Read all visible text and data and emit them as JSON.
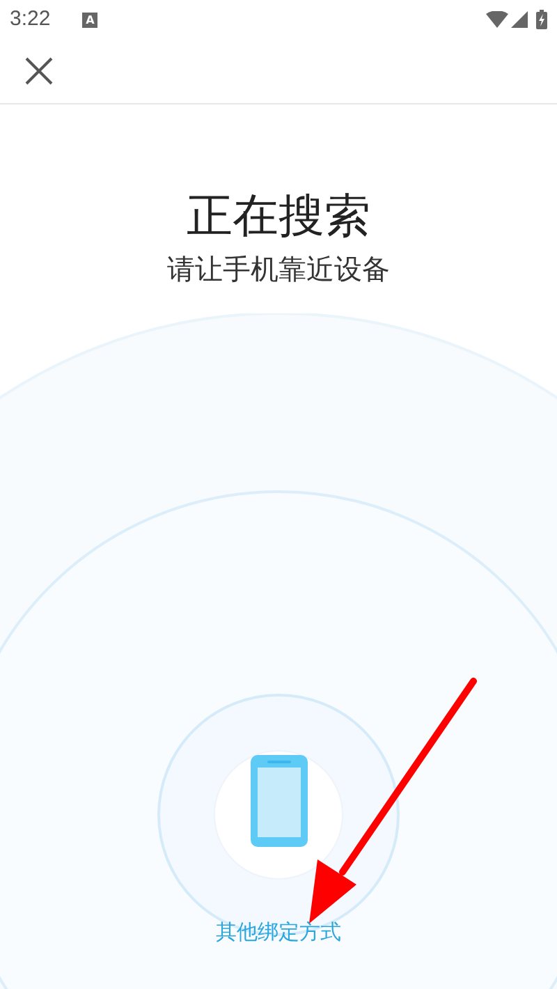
{
  "status_bar": {
    "time": "3:22",
    "notification_badge": "A"
  },
  "title": "正在搜索",
  "subtitle": "请让手机靠近设备",
  "link": "其他绑定方式"
}
